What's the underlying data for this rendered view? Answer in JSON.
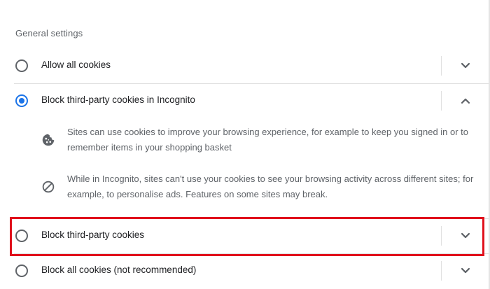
{
  "section": {
    "title": "General settings"
  },
  "options": [
    {
      "label": "Allow all cookies",
      "selected": false,
      "expanded": false
    },
    {
      "label": "Block third-party cookies in Incognito",
      "selected": true,
      "expanded": true
    },
    {
      "label": "Block third-party cookies",
      "selected": false,
      "expanded": false
    },
    {
      "label": "Block all cookies (not recommended)",
      "selected": false,
      "expanded": false
    }
  ],
  "incognito_details": [
    {
      "icon": "cookie-icon",
      "text": "Sites can use cookies to improve your browsing experience, for example to keep you signed in or to remember items in your shopping basket"
    },
    {
      "icon": "block-icon",
      "text": "While in Incognito, sites can't use your cookies to see your browsing activity across different sites; for example, to personalise ads. Features on some sites may break."
    }
  ],
  "colors": {
    "accent": "#1a73e8",
    "highlight": "#e0111c",
    "text_primary": "#202124",
    "text_secondary": "#5f6368",
    "divider": "#e0e0e0"
  }
}
